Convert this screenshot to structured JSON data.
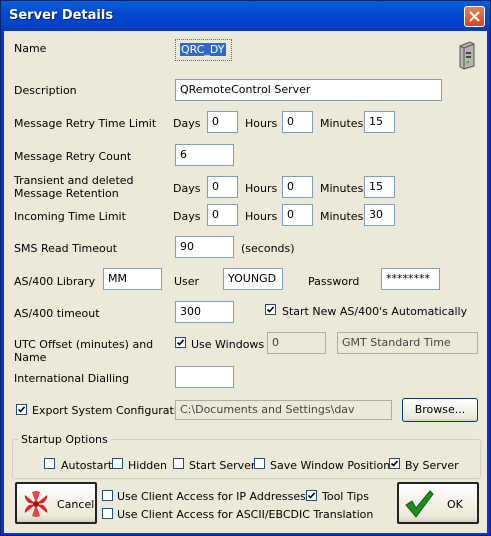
{
  "window": {
    "title": "Server Details"
  },
  "fields": {
    "name": {
      "label": "Name",
      "value": "QRC_DY"
    },
    "description": {
      "label": "Description",
      "value": "QRemoteControl Server"
    },
    "retry_limit": {
      "label": "Message Retry Time Limit",
      "days_label": "Days",
      "days": "0",
      "hours_label": "Hours",
      "hours": "0",
      "minutes_label": "Minutes",
      "minutes": "15"
    },
    "retry_count": {
      "label": "Message Retry Count",
      "value": "6"
    },
    "retention": {
      "label_line1": "Transient and deleted",
      "label_line2": "Message Retention",
      "days_label": "Days",
      "days": "0",
      "hours_label": "Hours",
      "hours": "0",
      "minutes_label": "Minutes",
      "minutes": "15"
    },
    "incoming": {
      "label": "Incoming Time Limit",
      "days_label": "Days",
      "days": "0",
      "hours_label": "Hours",
      "hours": "0",
      "minutes_label": "Minutes",
      "minutes": "30"
    },
    "sms": {
      "label": "SMS Read Timeout",
      "value": "90",
      "unit": "(seconds)"
    },
    "as400_library": {
      "label": "AS/400 Library",
      "value": "MM",
      "user_label": "User",
      "user": "YOUNGD",
      "password_label": "Password",
      "password": "********"
    },
    "as400_timeout": {
      "label": "AS/400 timeout",
      "value": "300",
      "auto_start_label": "Start New AS/400's Automatically"
    },
    "utc": {
      "label_line1": "UTC Offset (minutes) and",
      "label_line2": "Name",
      "use_windows_label": "Use Windows",
      "offset": "0",
      "zone": "GMT Standard Time"
    },
    "intl": {
      "label": "International Dialling",
      "value": ""
    },
    "export": {
      "label": "Export System Configuratio",
      "path": "C:\\Documents and Settings\\dav",
      "browse_label": "Browse..."
    }
  },
  "startup": {
    "title": "Startup Options",
    "autostart": "Autostart",
    "hidden": "Hidden",
    "start_server": "Start Server",
    "save_positions": "Save Window Positions",
    "by_server": "By Server"
  },
  "bottom": {
    "cancel_label": "Cancel",
    "ok_label": "OK",
    "client_ip": "Use Client Access for IP Addresses",
    "tool_tips": "Tool Tips",
    "client_ascii": "Use Client Access for ASCII/EBCDIC Translation"
  },
  "colors": {
    "title_bar": "#0449d1",
    "dialog": "#ece9d8",
    "ok_check": "#1e8e1e",
    "cancel_icon": "#d8232a"
  }
}
